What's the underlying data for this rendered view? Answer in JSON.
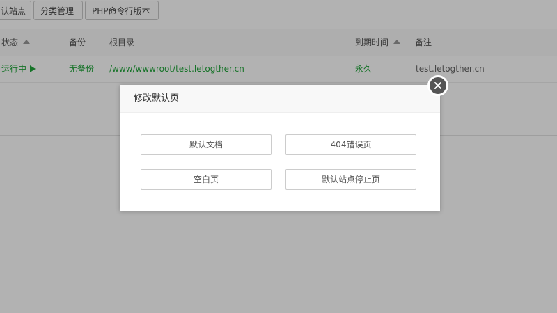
{
  "toolbar": {
    "buttons": [
      "认站点",
      "分类管理",
      "PHP命令行版本"
    ]
  },
  "table": {
    "headers": {
      "status": "状态",
      "backup": "备份",
      "root": "根目录",
      "expire": "到期时间",
      "remark": "备注"
    },
    "row": {
      "status": "运行中",
      "backup": "无备份",
      "root": "/www/wwwroot/test.letogther.cn",
      "expire": "永久",
      "remark": "test.letogther.cn"
    }
  },
  "dialog": {
    "title": "修改默认页",
    "options": [
      "默认文档",
      "404错误页",
      "空白页",
      "默认站点停止页"
    ]
  },
  "colors": {
    "accent_green": "#20a53a",
    "overlay": "rgba(0,0,0,0.30)"
  },
  "icons": {
    "sort": "sort-up-icon",
    "running": "play-icon",
    "close": "close-icon"
  }
}
